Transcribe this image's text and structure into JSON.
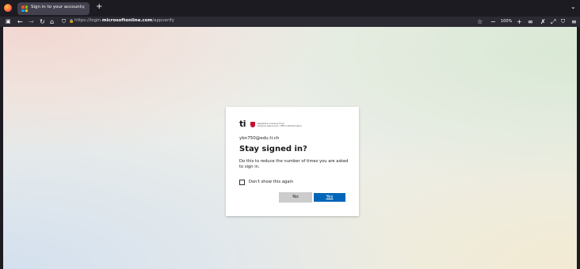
{
  "browser": {
    "tab": {
      "title": "Sign in to your account",
      "close_glyph": "×",
      "favicon": "microsoft-logo-icon"
    },
    "new_tab_glyph": "+",
    "tab_list_glyph": "⌄",
    "nav": {
      "back_glyph": "←",
      "forward_glyph": "→",
      "reload_glyph": "↻",
      "home_glyph": "⌂",
      "shield_glyph": "⛉",
      "lock_glyph": "🔒"
    },
    "url": {
      "prefix": "https://login.",
      "domain": "microsoftonline.com",
      "path": "/appverify"
    },
    "toolbar": {
      "star_glyph": "☆",
      "zoom_out_glyph": "−",
      "zoom_level": "100%",
      "zoom_in_glyph": "+",
      "glasses_glyph": "∞",
      "extensions_glyph": "✗",
      "pen_glyph": "⤢",
      "shield_glyph": "⛉",
      "menu_glyph": "≡"
    }
  },
  "dialog": {
    "org_logo_text": "ti",
    "org_line1": "Repubblica e Cantone Ticino",
    "org_line2": "Divisione della scuola • Ufficio dell'informatica",
    "account": "ybn750@edu.ti.ch",
    "title": "Stay signed in?",
    "description": "Do this to reduce the number of times you are asked to sign in.",
    "checkbox_label": "Don't show this again",
    "no_label": "No",
    "yes_label": "Yes"
  },
  "colors": {
    "accent": "#0067b8",
    "secondary_button": "#cccccc",
    "browser_chrome": "#1c1b22"
  }
}
